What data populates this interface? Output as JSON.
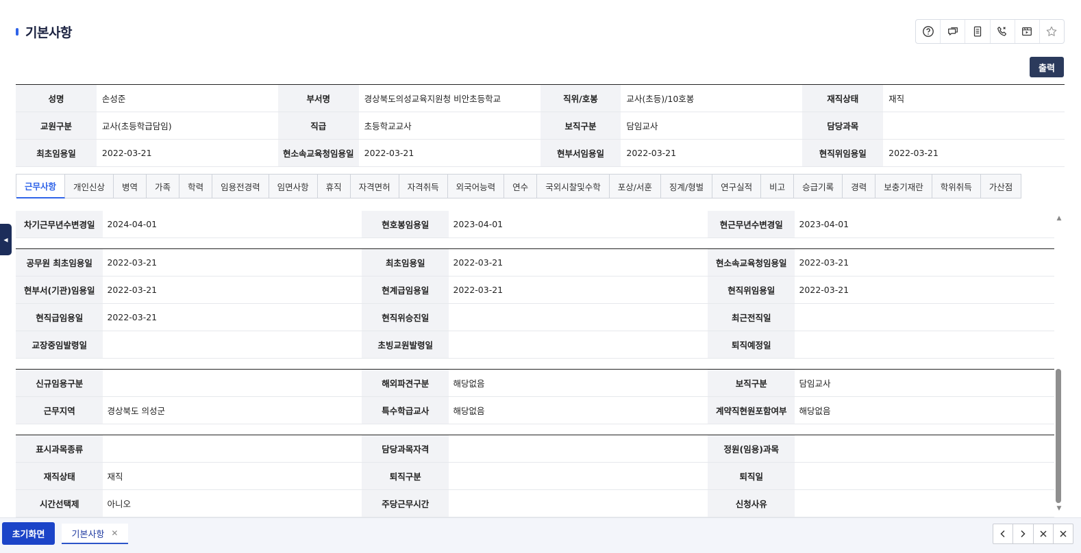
{
  "page": {
    "title": "기본사항"
  },
  "toolbar": {
    "print_label": "출력",
    "icons": [
      "help-icon",
      "chat-icon",
      "document-icon",
      "phone-icon",
      "video-icon",
      "star-icon"
    ]
  },
  "summary": {
    "rows": [
      [
        {
          "label": "성명",
          "value": "손성준"
        },
        {
          "label": "부서명",
          "value": "경상북도의성교육지원청 비안초등학교"
        },
        {
          "label": "직위/호봉",
          "value": "교사(초등)/10호봉"
        },
        {
          "label": "재직상태",
          "value": "재직"
        }
      ],
      [
        {
          "label": "교원구분",
          "value": "교사(초등학급담임)"
        },
        {
          "label": "직급",
          "value": "초등학교교사"
        },
        {
          "label": "보직구분",
          "value": "담임교사"
        },
        {
          "label": "담당과목",
          "value": ""
        }
      ],
      [
        {
          "label": "최초임용일",
          "value": "2022-03-21"
        },
        {
          "label": "현소속교육청임용일",
          "value": "2022-03-21"
        },
        {
          "label": "현부서임용일",
          "value": "2022-03-21"
        },
        {
          "label": "현직위임용일",
          "value": "2022-03-21"
        }
      ]
    ]
  },
  "tabs": [
    {
      "label": "근무사항",
      "active": true
    },
    {
      "label": "개인신상",
      "active": false
    },
    {
      "label": "병역",
      "active": false
    },
    {
      "label": "가족",
      "active": false
    },
    {
      "label": "학력",
      "active": false
    },
    {
      "label": "임용전경력",
      "active": false
    },
    {
      "label": "임면사항",
      "active": false
    },
    {
      "label": "휴직",
      "active": false
    },
    {
      "label": "자격면허",
      "active": false
    },
    {
      "label": "자격취득",
      "active": false
    },
    {
      "label": "외국어능력",
      "active": false
    },
    {
      "label": "연수",
      "active": false
    },
    {
      "label": "국외시찰및수학",
      "active": false
    },
    {
      "label": "포상/서훈",
      "active": false
    },
    {
      "label": "징계/형벌",
      "active": false
    },
    {
      "label": "연구실적",
      "active": false
    },
    {
      "label": "비고",
      "active": false
    },
    {
      "label": "승급기록",
      "active": false
    },
    {
      "label": "경력",
      "active": false
    },
    {
      "label": "보충기재란",
      "active": false
    },
    {
      "label": "학위취득",
      "active": false
    },
    {
      "label": "가산점",
      "active": false
    }
  ],
  "sections": [
    {
      "rows": [
        [
          {
            "label": "차기근무년수변경일",
            "value": "2024-04-01"
          },
          {
            "label": "현호봉임용일",
            "value": "2023-04-01"
          },
          {
            "label": "현근무년수변경일",
            "value": "2023-04-01"
          }
        ]
      ]
    },
    {
      "rows": [
        [
          {
            "label": "공무원 최초임용일",
            "value": "2022-03-21"
          },
          {
            "label": "최초임용일",
            "value": "2022-03-21"
          },
          {
            "label": "현소속교육청임용일",
            "value": "2022-03-21"
          }
        ],
        [
          {
            "label": "현부서(기관)임용일",
            "value": "2022-03-21"
          },
          {
            "label": "현계급임용일",
            "value": "2022-03-21"
          },
          {
            "label": "현직위임용일",
            "value": "2022-03-21"
          }
        ],
        [
          {
            "label": "현직급임용일",
            "value": "2022-03-21"
          },
          {
            "label": "현직위승진일",
            "value": ""
          },
          {
            "label": "최근전직일",
            "value": ""
          }
        ],
        [
          {
            "label": "교장중임발령일",
            "value": ""
          },
          {
            "label": "초빙교원발령일",
            "value": ""
          },
          {
            "label": "퇴직예정일",
            "value": ""
          }
        ]
      ]
    },
    {
      "rows": [
        [
          {
            "label": "신규임용구분",
            "value": ""
          },
          {
            "label": "해외파견구분",
            "value": "해당없음"
          },
          {
            "label": "보직구분",
            "value": "담임교사"
          }
        ],
        [
          {
            "label": "근무지역",
            "value": "경상북도 의성군"
          },
          {
            "label": "특수학급교사",
            "value": "해당없음"
          },
          {
            "label": "계약직현원포함여부",
            "value": "해당없음"
          }
        ]
      ]
    },
    {
      "rows": [
        [
          {
            "label": "표시과목종류",
            "value": ""
          },
          {
            "label": "담당과목자격",
            "value": ""
          },
          {
            "label": "정원(임용)과목",
            "value": ""
          }
        ],
        [
          {
            "label": "재직상태",
            "value": "재직"
          },
          {
            "label": "퇴직구분",
            "value": ""
          },
          {
            "label": "퇴직일",
            "value": ""
          }
        ],
        [
          {
            "label": "시간선택제",
            "value": "아니오"
          },
          {
            "label": "주당근무시간",
            "value": ""
          },
          {
            "label": "신청사유",
            "value": ""
          }
        ]
      ]
    }
  ],
  "bottom": {
    "home_label": "초기화면",
    "open_tab_label": "기본사항",
    "nav_icons": [
      "chevron-left-icon",
      "chevron-right-icon",
      "close-icon",
      "close-all-icon"
    ]
  },
  "colors": {
    "accent": "#2f63e8",
    "navy": "#2b3a5c",
    "home_button": "#1b44c8",
    "label_bg": "#f2f3f6"
  }
}
